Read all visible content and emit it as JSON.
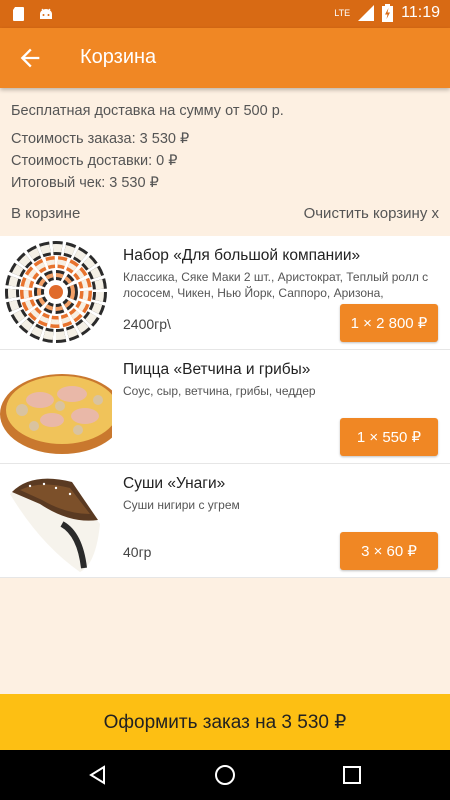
{
  "status_bar": {
    "time": "11:19",
    "network": "LTE",
    "icons": [
      "sd-card-icon",
      "android-icon",
      "signal-icon",
      "battery-charging-icon"
    ]
  },
  "app_bar": {
    "back_icon": "arrow-back-icon",
    "title": "Корзина"
  },
  "info": {
    "free_delivery": "Бесплатная доставка на сумму от 500 р.",
    "order_cost": "Стоимость заказа: 3 530 ₽",
    "delivery_cost": "Стоимость доставки: 0 ₽",
    "total": "Итоговый чек: 3 530 ₽"
  },
  "cart": {
    "heading": "В корзине",
    "clear": "Очистить корзину x",
    "items": [
      {
        "name": "Набор «Для большой компании»",
        "description": "Классика, Сяке Маки 2 шт., Аристократ, Теплый ролл с лососем, Чикен, Нью Йорк, Саппоро, Аризона, Калифорния",
        "weight": "2400гр\\",
        "button": "1 × 2 800 ₽"
      },
      {
        "name": "Пицца «Ветчина и грибы»",
        "description": "Соус, сыр, ветчина, грибы, чеддер",
        "weight": "",
        "button": "1 × 550 ₽"
      },
      {
        "name": "Суши «Унаги»",
        "description": "Суши нигири с угрем",
        "weight": "40гр",
        "button": "3 × 60 ₽"
      }
    ]
  },
  "order_button": "Оформить заказ на 3 530 ₽",
  "colors": {
    "status_bar": "#d86a14",
    "app_bar": "#f08724",
    "background": "#fdf0e2",
    "accent_button": "#f08724",
    "order_button": "#fdbf13"
  }
}
